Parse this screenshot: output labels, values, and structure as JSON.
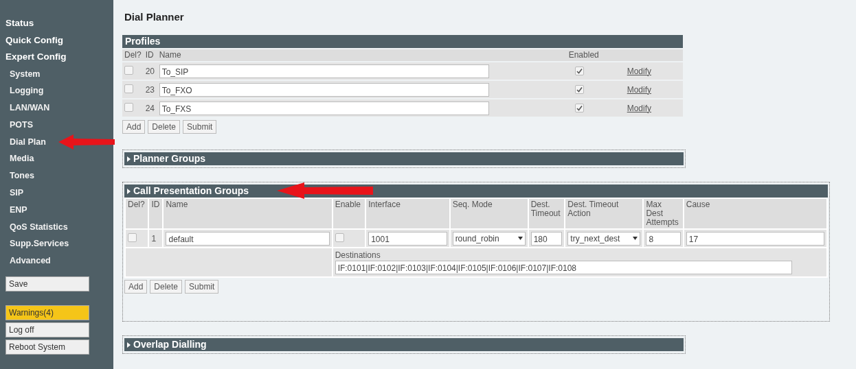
{
  "sidebar": {
    "items": [
      {
        "label": "Status"
      },
      {
        "label": "Quick Config"
      },
      {
        "label": "Expert Config",
        "children": [
          {
            "label": "System"
          },
          {
            "label": "Logging"
          },
          {
            "label": "LAN/WAN"
          },
          {
            "label": "POTS"
          },
          {
            "label": "Dial Plan"
          },
          {
            "label": "Media"
          },
          {
            "label": "Tones"
          },
          {
            "label": "SIP"
          },
          {
            "label": "ENP"
          },
          {
            "label": "QoS Statistics"
          },
          {
            "label": "Supp.Services"
          },
          {
            "label": "Advanced"
          }
        ]
      }
    ],
    "save_button": "Save",
    "buttons": [
      {
        "label": "Warnings(4)",
        "kind": "warning"
      },
      {
        "label": "Log off",
        "kind": "normal"
      },
      {
        "label": "Reboot System",
        "kind": "normal"
      }
    ]
  },
  "page_title": "Dial Planner",
  "profiles": {
    "title": "Profiles",
    "columns": [
      "Del?",
      "ID",
      "Name",
      "Enabled"
    ],
    "rows": [
      {
        "del": false,
        "id": "20",
        "name": "To_SIP",
        "enabled": true,
        "link": "Modify"
      },
      {
        "del": false,
        "id": "23",
        "name": "To_FXO",
        "enabled": true,
        "link": "Modify"
      },
      {
        "del": false,
        "id": "24",
        "name": "To_FXS",
        "enabled": true,
        "link": "Modify"
      }
    ],
    "buttons": [
      "Add",
      "Delete",
      "Submit"
    ]
  },
  "sections": [
    {
      "title": "Planner Groups",
      "expanded": false
    },
    {
      "title": "Call Presentation Groups",
      "expanded": true,
      "columns": [
        "Del?",
        "ID",
        "Name",
        "Enable",
        "Interface",
        "Seq. Mode",
        "Dest. Timeout",
        "Dest. Timeout Action",
        "Max Dest Attempts",
        "Cause"
      ],
      "rows": [
        {
          "del": false,
          "id": "1",
          "name": "default",
          "enable": false,
          "interface": "1001",
          "seq_mode": "round_robin",
          "timeout": "180",
          "timeout_action": "try_next_dest",
          "max_attempts": "8",
          "cause": "17",
          "destinations_label": "Destinations",
          "destinations": "IF:0101|IF:0102|IF:0103|IF:0104|IF:0105|IF:0106|IF:0107|IF:0108"
        }
      ],
      "buttons": [
        "Add",
        "Delete",
        "Submit"
      ]
    },
    {
      "title": "Overlap Dialling",
      "expanded": false
    }
  ]
}
